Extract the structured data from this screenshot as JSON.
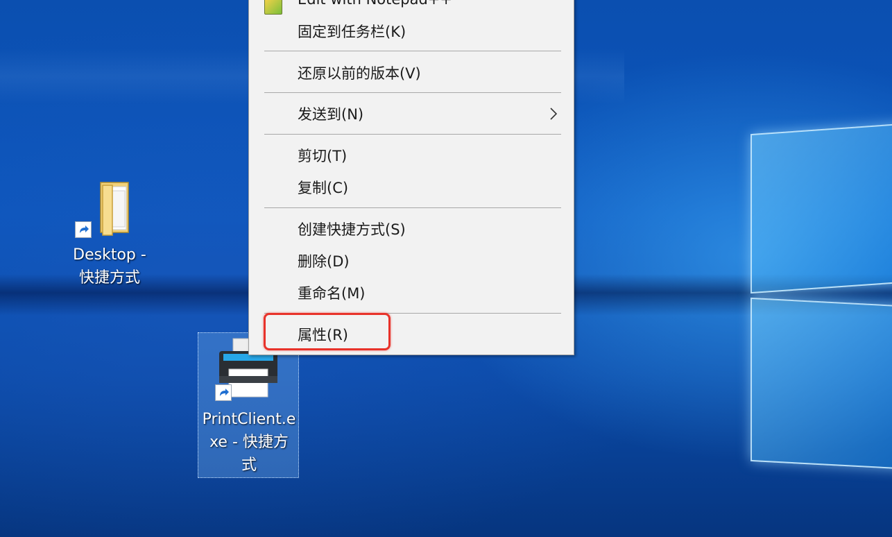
{
  "context_menu": {
    "items": [
      {
        "label": "Edit with Notepad++",
        "icon": "notepad-plus-plus-icon"
      },
      {
        "label": "固定到任务栏(K)"
      },
      {
        "label": "还原以前的版本(V)"
      },
      {
        "label": "发送到(N)",
        "submenu": true
      },
      {
        "label": "剪切(T)"
      },
      {
        "label": "复制(C)"
      },
      {
        "label": "创建快捷方式(S)"
      },
      {
        "label": "删除(D)"
      },
      {
        "label": "重命名(M)"
      },
      {
        "label": "属性(R)",
        "highlighted": true
      }
    ]
  },
  "desktop_icons": [
    {
      "label_line1": "Desktop -",
      "label_line2": "快捷方式",
      "icon": "folder-shortcut-icon"
    },
    {
      "label_line1": "PrintClient.e",
      "label_line2": "xe - 快捷方",
      "label_line3": "式",
      "icon": "printer-shortcut-icon",
      "selected": true
    }
  ],
  "colors": {
    "highlight_border": "#e8322a",
    "menu_background": "#f2f2f2",
    "desktop_blue": "#0a56bd"
  }
}
